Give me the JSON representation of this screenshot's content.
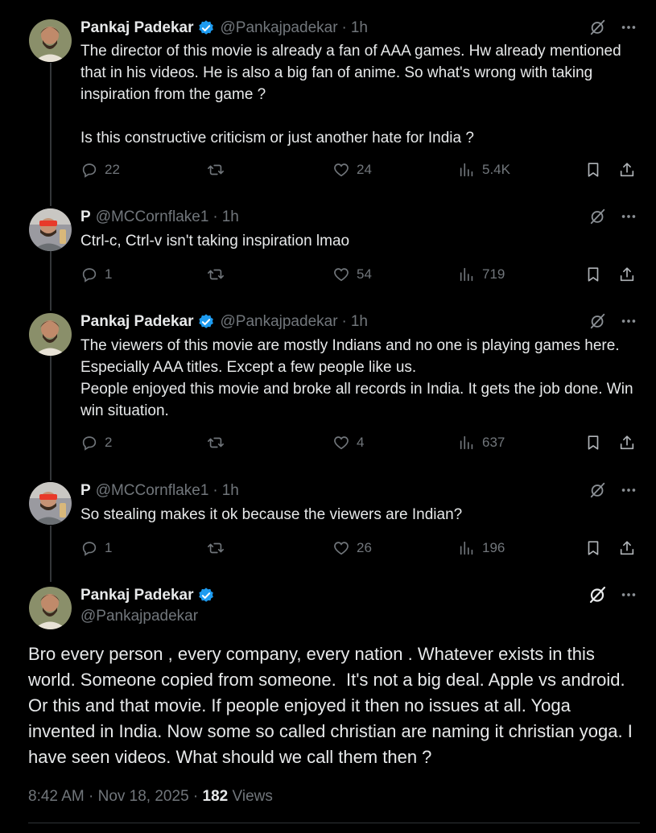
{
  "colors": {
    "accent": "#1d9bf0",
    "muted": "#71767b",
    "text": "#e7e9ea",
    "background": "#000000"
  },
  "replies": [
    {
      "name": "Pankaj Padekar",
      "verified": true,
      "handle": "@Pankajpadekar",
      "time": "1h",
      "text": "The director of this movie is already a fan of AAA games. Hw already mentioned that in his videos. He is also a big fan of anime. So what's wrong with taking inspiration from the game ?\n\nIs this constructive criticism or just another hate for India ?",
      "replies": "22",
      "reposts": "",
      "likes": "24",
      "views": "5.4K"
    },
    {
      "name": "P",
      "verified": false,
      "handle": "@MCCornflake1",
      "time": "1h",
      "text": "Ctrl-c, Ctrl-v isn't taking inspiration lmao",
      "replies": "1",
      "reposts": "",
      "likes": "54",
      "views": "719"
    },
    {
      "name": "Pankaj Padekar",
      "verified": true,
      "handle": "@Pankajpadekar",
      "time": "1h",
      "text": "The viewers of this movie are mostly Indians and no one is playing games here. Especially AAA titles. Except a few people like us.\nPeople enjoyed this movie and broke all records in India. It gets the job done. Win win situation.",
      "replies": "2",
      "reposts": "",
      "likes": "4",
      "views": "637"
    },
    {
      "name": "P",
      "verified": false,
      "handle": "@MCCornflake1",
      "time": "1h",
      "text": "So stealing makes it ok because the viewers are Indian?",
      "replies": "1",
      "reposts": "",
      "likes": "26",
      "views": "196"
    }
  ],
  "main": {
    "name": "Pankaj Padekar",
    "handle": "@Pankajpadekar",
    "text": "Bro every person , every company, every nation . Whatever exists in this world. Someone copied from someone.  It's not a big deal. Apple vs android. Or this and that movie. If people enjoyed it then no issues at all. Yoga invented in India. Now some so called christian are naming it christian yoga. I have seen videos. What should we call them then ?",
    "time": "8:42 AM",
    "date": "Nov 18, 2025",
    "views_count": "182",
    "views_label": "Views"
  },
  "icons": [
    "grok-icon",
    "more-icon",
    "reply-icon",
    "repost-icon",
    "like-icon",
    "views-icon",
    "bookmark-icon",
    "share-icon",
    "verified-icon"
  ]
}
